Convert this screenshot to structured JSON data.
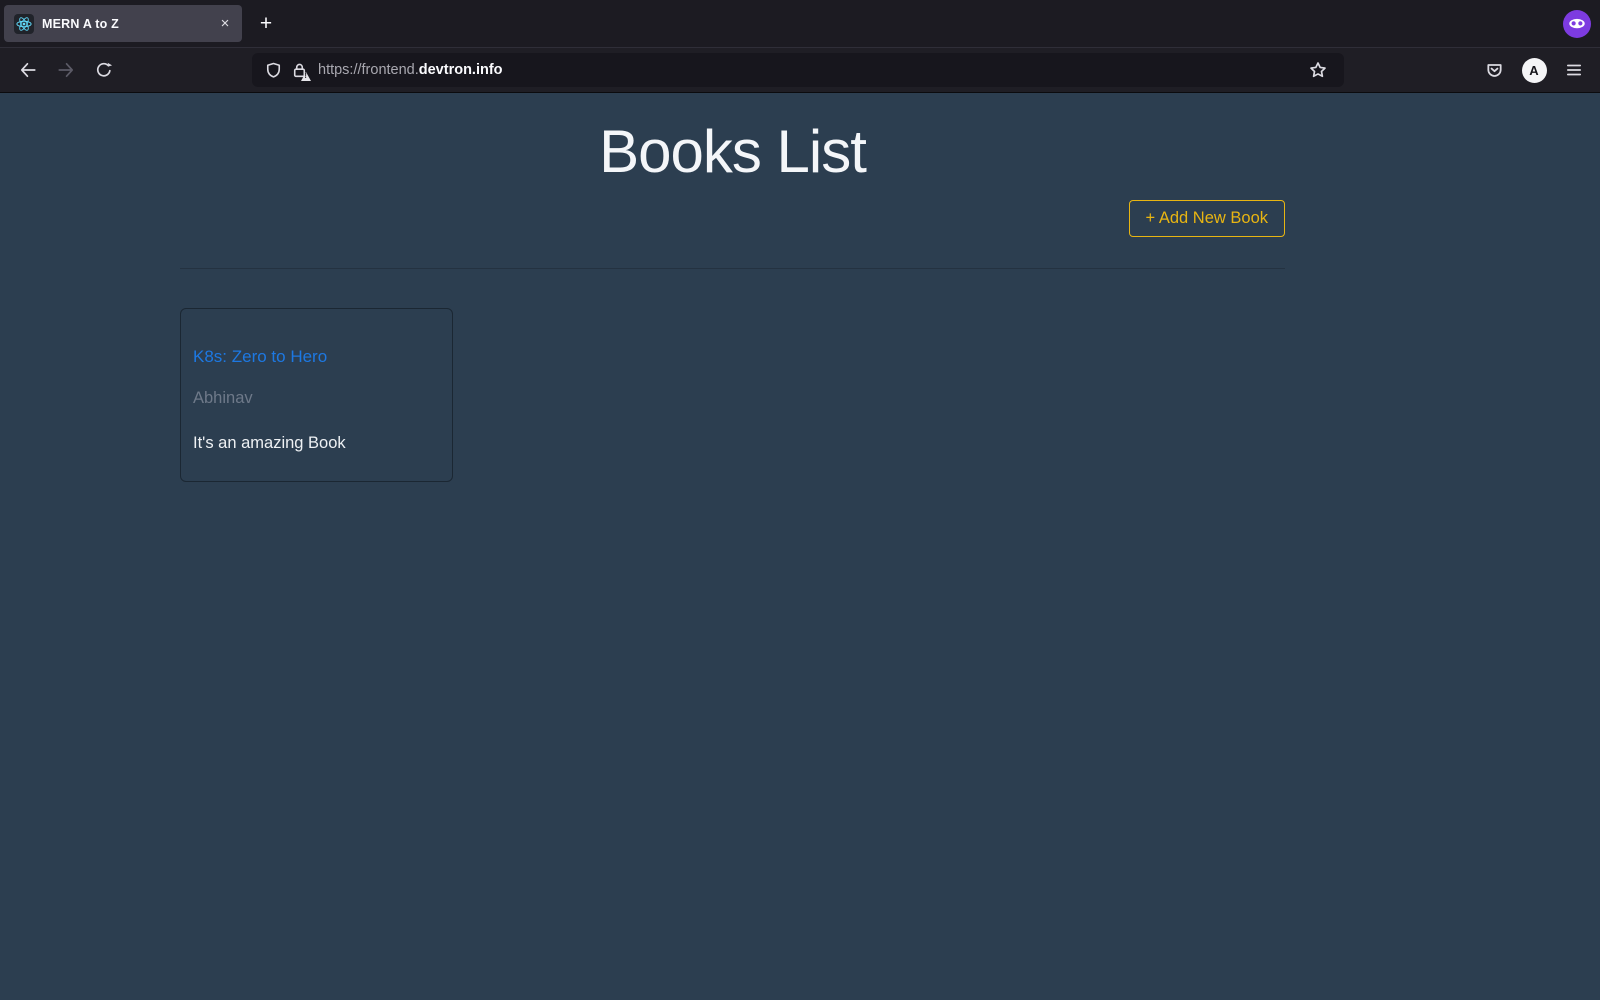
{
  "browser": {
    "tab_bar": {
      "active_tab": {
        "title": "MERN A to Z",
        "close_glyph": "×"
      },
      "new_tab_glyph": "+"
    },
    "toolbar": {
      "url": {
        "prefix": "https://frontend.",
        "domain": "devtron.info"
      },
      "account_initial": "A"
    }
  },
  "page": {
    "heading": "Books List",
    "add_book_button": "+ Add New Book",
    "books": [
      {
        "title": "K8s: Zero to Hero",
        "author": "Abhinav",
        "description": "It's an amazing Book"
      }
    ]
  },
  "icons": {
    "tab_favicon": "react-logo-icon",
    "url_security": [
      "shield-icon",
      "lock-warning-icon"
    ],
    "toolbar_right": [
      "pocket-icon",
      "account-icon",
      "menu-icon"
    ],
    "window_badge": "private-browsing-mask-icon"
  },
  "colors": {
    "page_background": "#2c3e50",
    "accent_yellow": "#e8b512",
    "link_blue": "#1d78e2",
    "author_gray": "#6e7989",
    "react_cyan": "#61dafb",
    "private_badge_purple": "#7d3be0",
    "chrome_dark": "#1c1b22",
    "active_tab": "#42414d"
  }
}
